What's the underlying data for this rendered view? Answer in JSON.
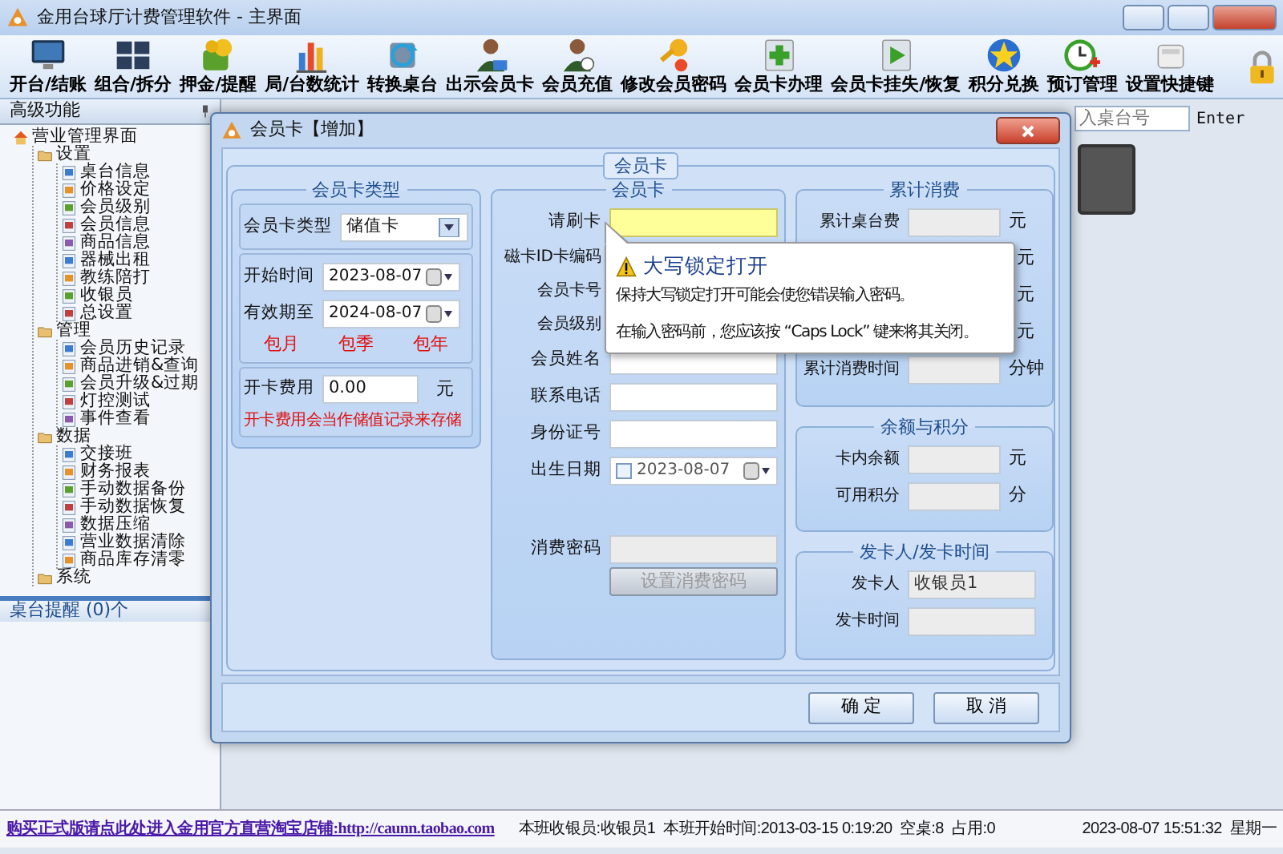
{
  "window": {
    "title": "金用台球厅计费管理软件 - 主界面"
  },
  "toolbar": [
    {
      "label": "开台/结账"
    },
    {
      "label": "组合/拆分"
    },
    {
      "label": "押金/提醒"
    },
    {
      "label": "局/台数统计"
    },
    {
      "label": "转换桌台"
    },
    {
      "label": "出示会员卡"
    },
    {
      "label": "会员充值"
    },
    {
      "label": "修改会员密码"
    },
    {
      "label": "会员卡办理"
    },
    {
      "label": "会员卡挂失/恢复"
    },
    {
      "label": "积分兑换"
    },
    {
      "label": "预订管理"
    },
    {
      "label": "设置快捷键"
    }
  ],
  "side_panel": {
    "title": "高级功能",
    "tree": [
      {
        "label": "营业管理界面",
        "children": [
          {
            "label": "设置",
            "children": [
              {
                "label": "桌台信息"
              },
              {
                "label": "价格设定"
              },
              {
                "label": "会员级别"
              },
              {
                "label": "会员信息"
              },
              {
                "label": "商品信息"
              },
              {
                "label": "器械出租"
              },
              {
                "label": "教练陪打"
              },
              {
                "label": "收银员"
              },
              {
                "label": "总设置"
              }
            ]
          },
          {
            "label": "管理",
            "children": [
              {
                "label": "会员历史记录"
              },
              {
                "label": "商品进销&查询"
              },
              {
                "label": "会员升级&过期"
              },
              {
                "label": "灯控测试"
              },
              {
                "label": "事件查看"
              }
            ]
          },
          {
            "label": "数据",
            "children": [
              {
                "label": "交接班"
              },
              {
                "label": "财务报表"
              },
              {
                "label": "手动数据备份"
              },
              {
                "label": "手动数据恢复"
              },
              {
                "label": "数据压缩"
              },
              {
                "label": "营业数据清除"
              },
              {
                "label": "商品库存清零"
              }
            ]
          },
          {
            "label": "系统"
          }
        ]
      }
    ]
  },
  "reminder_panel": {
    "title": "桌台提醒 (0)个"
  },
  "table_search": {
    "placeholder": "入桌台号",
    "button": "Enter"
  },
  "dialog": {
    "title": "会员卡【增加】",
    "section_title": "会员卡",
    "card_type_group": {
      "title": "会员卡类型",
      "type_label": "会员卡类型",
      "type_value": "储值卡",
      "dates": [
        {
          "label": "开始时间",
          "value": "2023-08-07"
        },
        {
          "label": "有效期至",
          "value": "2024-08-07"
        }
      ],
      "quick_periods": [
        "包月",
        "包季",
        "包年"
      ],
      "fee_label": "开卡费用",
      "fee_value": "0.00",
      "fee_unit": "元",
      "note": "开卡费用会当作储值记录来存储"
    },
    "member_group": {
      "title": "会员卡",
      "fields": [
        {
          "kind": "text",
          "label": "请刷卡",
          "focused": true
        },
        {
          "kind": "covered",
          "label": "磁卡ID卡编码"
        },
        {
          "kind": "covered",
          "label": "会员卡号"
        },
        {
          "kind": "covered",
          "label": "会员级别"
        },
        {
          "kind": "text",
          "label": "会员姓名",
          "focused": false
        },
        {
          "kind": "text",
          "label": "联系电话",
          "focused": false
        },
        {
          "kind": "text",
          "label": "身份证号",
          "focused": false
        },
        {
          "kind": "date",
          "label": "出生日期",
          "value": "2023-08-07",
          "checked": false
        },
        {
          "kind": "password",
          "label": "消费密码",
          "disabled": true
        }
      ],
      "set_password_button": {
        "label": "设置消费密码",
        "disabled": true
      }
    },
    "consumption_group": {
      "title": "累计消费",
      "rows": [
        {
          "kind": "field",
          "label": "累计桌台费",
          "unit": "元"
        },
        {
          "kind": "covered",
          "unit": "元"
        },
        {
          "kind": "covered",
          "unit": "元"
        },
        {
          "kind": "covered",
          "unit": "元"
        },
        {
          "kind": "field",
          "label": "累计消费时间",
          "unit": "分钟"
        }
      ]
    },
    "balance_group": {
      "title": "余额与积分",
      "rows": [
        {
          "kind": "field",
          "label": "卡内余额",
          "unit": "元"
        },
        {
          "kind": "field",
          "label": "可用积分",
          "unit": "分"
        }
      ]
    },
    "issuer_group": {
      "title": "发卡人/发卡时间",
      "rows": [
        {
          "kind": "field",
          "label": "发卡人",
          "value": "收银员1"
        },
        {
          "kind": "field",
          "label": "发卡时间"
        }
      ]
    },
    "buttons": [
      "确 定",
      "取 消"
    ],
    "tooltip": {
      "title": "大写锁定打开",
      "lines": [
        "保持大写锁定打开可能会使您错误输入密码。",
        "在输入密码前，您应该按 “Caps Lock” 键来将其关闭。"
      ]
    }
  },
  "status_bar": {
    "link": "购买正式版请点此处进入金用官方直营淘宝店铺:http://caunn.taobao.com",
    "items": [
      "本班收银员:收银员1",
      "本班开始时间:2013-03-15 0:19:20",
      "空桌:8",
      "占用:0",
      "2023-08-07 15:51:32",
      "星期一"
    ]
  }
}
